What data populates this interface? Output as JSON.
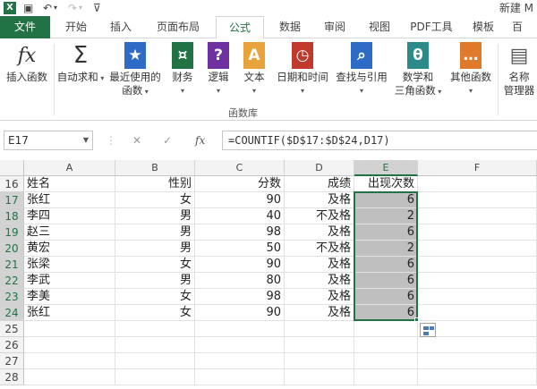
{
  "titlebar": {
    "title": "新建 M"
  },
  "tabs": [
    {
      "label": "文件",
      "key": "file"
    },
    {
      "label": "开始",
      "key": "home"
    },
    {
      "label": "插入",
      "key": "insert"
    },
    {
      "label": "页面布局",
      "key": "layout"
    },
    {
      "label": "公式",
      "key": "formulas"
    },
    {
      "label": "数据",
      "key": "data"
    },
    {
      "label": "审阅",
      "key": "review"
    },
    {
      "label": "视图",
      "key": "view"
    },
    {
      "label": "PDF工具",
      "key": "pdf"
    },
    {
      "label": "模板",
      "key": "template"
    },
    {
      "label": "百",
      "key": "more"
    }
  ],
  "ribbon": {
    "buttons": [
      {
        "line1": "插入函数",
        "line2": "",
        "icon": "fx-icon",
        "glyph": "fx",
        "color": "#444444"
      },
      {
        "line1": "自动求和",
        "line2": "",
        "icon": "sigma-icon",
        "glyph": "Σ",
        "color": "#444444"
      },
      {
        "line1": "最近使用的",
        "line2": "函数",
        "icon": "star-book-icon",
        "glyph": "★",
        "color": "#2e6bc6"
      },
      {
        "line1": "财务",
        "line2": "",
        "icon": "finance-book-icon",
        "glyph": "¤",
        "color": "#217346"
      },
      {
        "line1": "逻辑",
        "line2": "",
        "icon": "logic-book-icon",
        "glyph": "?",
        "color": "#7030a0"
      },
      {
        "line1": "文本",
        "line2": "",
        "icon": "text-book-icon",
        "glyph": "A",
        "color": "#e8a33d"
      },
      {
        "line1": "日期和时间",
        "line2": "",
        "icon": "date-book-icon",
        "glyph": "◷",
        "color": "#c0392b"
      },
      {
        "line1": "查找与引用",
        "line2": "",
        "icon": "lookup-book-icon",
        "glyph": "⌕",
        "color": "#2e6bc6"
      },
      {
        "line1": "数学和",
        "line2": "三角函数",
        "icon": "math-book-icon",
        "glyph": "θ",
        "color": "#2c8a8a"
      },
      {
        "line1": "其他函数",
        "line2": "",
        "icon": "other-book-icon",
        "glyph": "…",
        "color": "#e07a2b"
      },
      {
        "line1": "名称",
        "line2": "管理器",
        "icon": "name-manager-icon",
        "glyph": "▤",
        "color": "#555555"
      }
    ],
    "group_label": "函数库"
  },
  "formula_bar": {
    "name_box": "E17",
    "formula": "=COUNTIF($D$17:$D$24,D17)",
    "cancel_glyph": "✕",
    "enter_glyph": "✓",
    "fx_glyph": "fx"
  },
  "grid": {
    "columns": [
      "A",
      "B",
      "C",
      "D",
      "E",
      "F"
    ],
    "selected_column": "E",
    "rows": [
      {
        "num": "16",
        "cells": [
          "姓名",
          "性别",
          "分数",
          "成绩",
          "出现次数",
          ""
        ]
      },
      {
        "num": "17",
        "cells": [
          "张红",
          "女",
          "90",
          "及格",
          "6",
          ""
        ]
      },
      {
        "num": "18",
        "cells": [
          "李四",
          "男",
          "40",
          "不及格",
          "2",
          ""
        ]
      },
      {
        "num": "19",
        "cells": [
          "赵三",
          "男",
          "98",
          "及格",
          "6",
          ""
        ]
      },
      {
        "num": "20",
        "cells": [
          "黄宏",
          "男",
          "50",
          "不及格",
          "2",
          ""
        ]
      },
      {
        "num": "21",
        "cells": [
          "张梁",
          "女",
          "90",
          "及格",
          "6",
          ""
        ]
      },
      {
        "num": "22",
        "cells": [
          "李武",
          "男",
          "80",
          "及格",
          "6",
          ""
        ]
      },
      {
        "num": "23",
        "cells": [
          "李美",
          "女",
          "98",
          "及格",
          "6",
          ""
        ]
      },
      {
        "num": "24",
        "cells": [
          "张红",
          "女",
          "90",
          "及格",
          "6",
          ""
        ]
      },
      {
        "num": "25",
        "cells": [
          "",
          "",
          "",
          "",
          "",
          ""
        ]
      },
      {
        "num": "26",
        "cells": [
          "",
          "",
          "",
          "",
          "",
          ""
        ]
      },
      {
        "num": "27",
        "cells": [
          "",
          "",
          "",
          "",
          "",
          ""
        ]
      },
      {
        "num": "28",
        "cells": [
          "",
          "",
          "",
          "",
          "",
          ""
        ]
      }
    ]
  }
}
